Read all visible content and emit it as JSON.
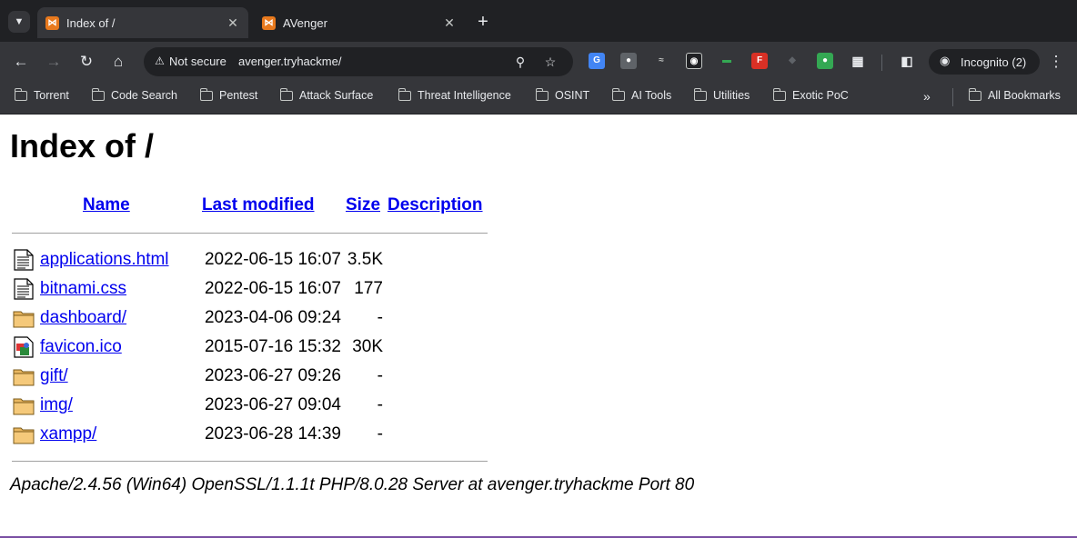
{
  "browser": {
    "tabs": [
      {
        "title": "Index of /",
        "favicon": "xampp-icon",
        "active": true
      },
      {
        "title": "AVenger",
        "favicon": "xampp-icon",
        "active": false
      }
    ],
    "toolbar": {
      "security_label": "Not secure",
      "url": "avenger.tryhackme/",
      "profile_label": "Incognito (2)"
    },
    "bookmarks": [
      {
        "label": "Torrent"
      },
      {
        "label": "Code Search"
      },
      {
        "label": "Pentest"
      },
      {
        "label": "Attack Surface"
      },
      {
        "label": "Threat Intelligence"
      },
      {
        "label": "OSINT"
      },
      {
        "label": "AI Tools"
      },
      {
        "label": "Utilities"
      },
      {
        "label": "Exotic PoC"
      },
      {
        "label": "All Bookmarks"
      }
    ],
    "colors": {
      "chrome_dark": "#202124",
      "toolbar": "#35363a",
      "xampp_orange": "#e8791d",
      "link": "#0000ee"
    }
  },
  "page": {
    "heading": "Index of /",
    "columns": {
      "name": "Name",
      "last_modified": "Last modified",
      "size": "Size",
      "description": "Description"
    },
    "entries": [
      {
        "name": "applications.html",
        "modified": "2022-06-15 16:07",
        "size": "3.5K",
        "icon": "text-file-icon"
      },
      {
        "name": "bitnami.css",
        "modified": "2022-06-15 16:07",
        "size": "177",
        "icon": "text-file-icon"
      },
      {
        "name": "dashboard/",
        "modified": "2023-04-06 09:24",
        "size": "-",
        "icon": "folder-icon"
      },
      {
        "name": "favicon.ico",
        "modified": "2015-07-16 15:32",
        "size": "30K",
        "icon": "image-file-icon"
      },
      {
        "name": "gift/",
        "modified": "2023-06-27 09:26",
        "size": "-",
        "icon": "folder-icon"
      },
      {
        "name": "img/",
        "modified": "2023-06-27 09:04",
        "size": "-",
        "icon": "folder-icon"
      },
      {
        "name": "xampp/",
        "modified": "2023-06-28 14:39",
        "size": "-",
        "icon": "folder-icon"
      }
    ],
    "footer": "Apache/2.4.56 (Win64) OpenSSL/1.1.1t PHP/8.0.28 Server at avenger.tryhackme Port 80"
  }
}
